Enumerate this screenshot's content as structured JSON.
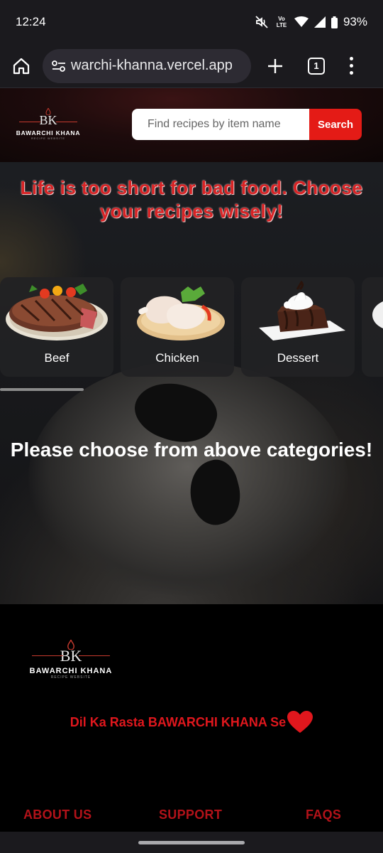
{
  "status_bar": {
    "time": "12:24",
    "volte_label": "Vo LTE",
    "battery": "93%",
    "icons": [
      "mute-icon",
      "volte-icon",
      "wifi-icon",
      "signal-icon",
      "battery-icon"
    ]
  },
  "browser": {
    "url": "warchi-khanna.vercel.app",
    "tab_count": "1",
    "icons": [
      "home-icon",
      "site-settings-icon",
      "plus-icon",
      "tabs-icon",
      "menu-icon"
    ]
  },
  "header": {
    "logo_mark": "BK",
    "logo_name": "BAWARCHI KHANA",
    "logo_tagline": "RECIPE WEBSITE",
    "search_placeholder": "Find recipes by item name",
    "search_button": "Search",
    "brand_color": "#e41b16"
  },
  "hero": {
    "title": "Life is too short for bad food. Choose your recipes wisely!",
    "categories": [
      {
        "label": "Beef",
        "icon": "beef-steak-icon"
      },
      {
        "label": "Chicken",
        "icon": "chicken-legs-icon"
      },
      {
        "label": "Dessert",
        "icon": "brownie-dessert-icon"
      }
    ],
    "empty_message": "Please choose from above categories!"
  },
  "footer": {
    "logo_mark": "BK",
    "logo_name": "BAWARCHI KHANA",
    "logo_tagline": "RECIPE WEBSITE",
    "tagline": "Dil Ka Rasta BAWARCHI KHANA Se",
    "links": [
      "ABOUT US",
      "SUPPORT",
      "FAQS"
    ],
    "link_color": "#b21219"
  }
}
